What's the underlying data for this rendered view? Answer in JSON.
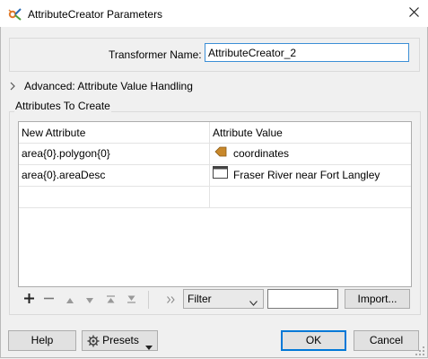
{
  "window": {
    "title": "AttributeCreator Parameters",
    "icon": "transformer-gear-icon",
    "close_icon": "close-icon"
  },
  "transformer": {
    "name_label": "Transformer Name:",
    "name_value": "AttributeCreator_2"
  },
  "advanced": {
    "label": "Advanced: Attribute Value Handling",
    "expanded": false
  },
  "attributes": {
    "group_label": "Attributes To Create",
    "columns": [
      "New Attribute",
      "Attribute Value"
    ],
    "rows": [
      {
        "name": "area{0}.polygon{0}",
        "value": "coordinates",
        "value_icon": "attribute-value-icon"
      },
      {
        "name": "area{0}.areaDesc",
        "value": "Fraser River near Fort Langley",
        "value_icon": "text-value-icon"
      }
    ]
  },
  "toolbar": {
    "add_icon": "add-icon",
    "remove_icon": "remove-icon",
    "move_up_icon": "move-up-icon",
    "move_down_icon": "move-down-icon",
    "move_top_icon": "move-top-icon",
    "move_bottom_icon": "move-bottom-icon",
    "more_icon": "more-icon",
    "filter_select": "Filter",
    "filter_value": "",
    "import_label": "Import..."
  },
  "buttons": {
    "help": "Help",
    "presets": "Presets",
    "ok": "OK",
    "cancel": "Cancel"
  },
  "colors": {
    "accent": "#0078d7",
    "attribute_icon": "#c8882b"
  }
}
